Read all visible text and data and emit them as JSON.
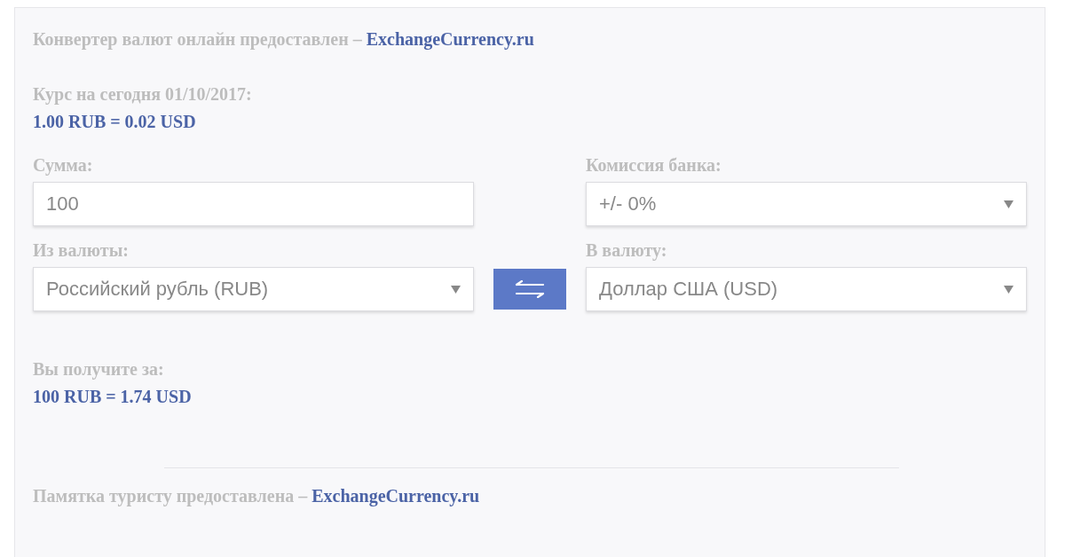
{
  "header": {
    "text": "Конвертер валют онлайн предоставлен –",
    "link": "ExchangeCurrency.ru"
  },
  "rate": {
    "label": "Курс на сегодня 01/10/2017:",
    "value": "1.00 RUB = 0.02 USD"
  },
  "amount": {
    "label": "Сумма:",
    "value": "100"
  },
  "commission": {
    "label": "Комиссия банка:",
    "value": "+/- 0%"
  },
  "from": {
    "label": "Из валюты:",
    "value": "Российский рубль (RUB)"
  },
  "to": {
    "label": "В валюту:",
    "value": "Доллар США (USD)"
  },
  "result": {
    "label": "Вы получите за:",
    "value": "100 RUB = 1.74 USD"
  },
  "footer": {
    "text": "Памятка туристу предоставлена –",
    "link": "ExchangeCurrency.ru"
  }
}
